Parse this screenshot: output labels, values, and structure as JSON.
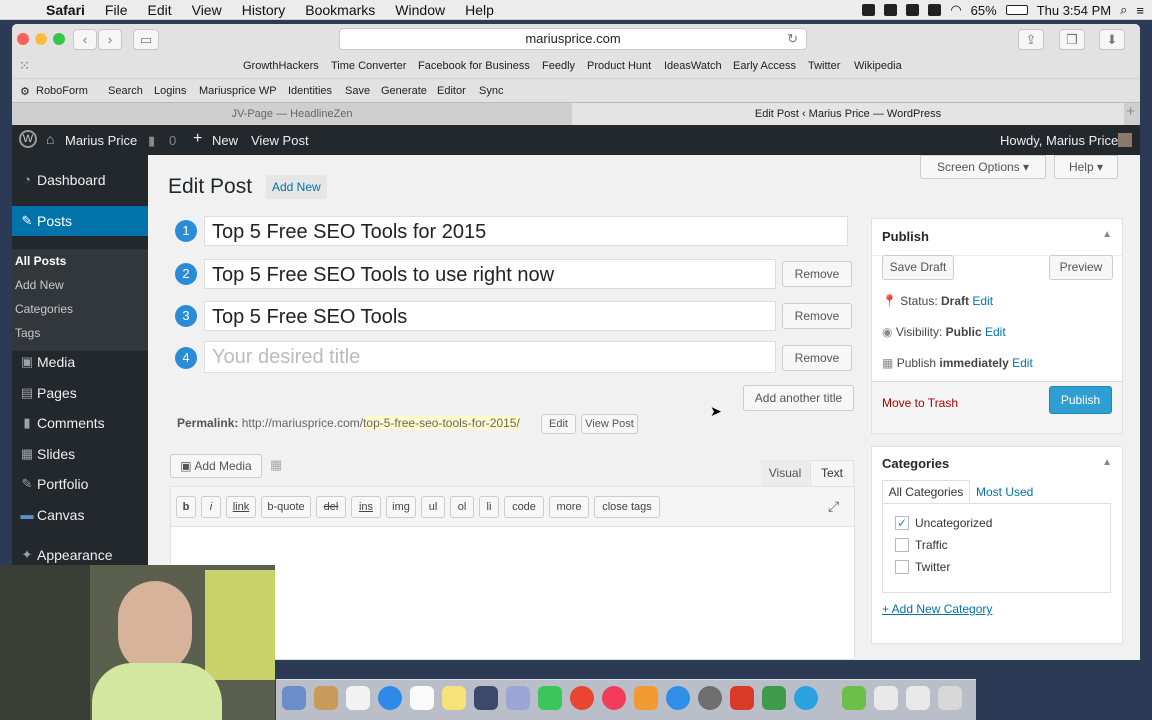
{
  "mac_menu": {
    "app": "Safari",
    "items": [
      "File",
      "Edit",
      "View",
      "History",
      "Bookmarks",
      "Window",
      "Help"
    ],
    "battery": "65%",
    "clock": "Thu 3:54 PM"
  },
  "browser": {
    "url": "mariusprice.com",
    "favorites": [
      "GrowthHackers",
      "Time Converter",
      "Facebook for Business",
      "Feedly",
      "Product Hunt",
      "IdeasWatch",
      "Early Access",
      "Twitter",
      "Wikipedia"
    ],
    "roboform": [
      "RoboForm",
      "Search",
      "Logins",
      "Mariusprice WP",
      "Identities",
      "Save",
      "Generate",
      "Editor",
      "Sync"
    ],
    "tabs": [
      "JV-Page — HeadlineZen",
      "Edit Post ‹ Marius Price — WordPress"
    ]
  },
  "adminbar": {
    "site": "Marius Price",
    "comments": "0",
    "new": "New",
    "view_post": "View Post",
    "howdy": "Howdy, Marius Price"
  },
  "sidebar": {
    "items": [
      "Dashboard",
      "Posts",
      "Media",
      "Pages",
      "Comments",
      "Slides",
      "Portfolio",
      "Canvas",
      "Appearance"
    ],
    "submenu": [
      "All Posts",
      "Add New",
      "Categories",
      "Tags"
    ]
  },
  "page": {
    "title": "Edit Post",
    "add_new": "Add New",
    "screen_options": "Screen Options",
    "help": "Help"
  },
  "titles": [
    {
      "num": "1",
      "value": "Top 5 Free SEO Tools for 2015"
    },
    {
      "num": "2",
      "value": "Top 5 Free SEO Tools to use right now",
      "action": "Remove"
    },
    {
      "num": "3",
      "value": "Top 5 Free SEO Tools",
      "action": "Remove"
    },
    {
      "num": "4",
      "placeholder": "Your desired title",
      "action": "Remove"
    }
  ],
  "add_title": "Add another title",
  "permalink": {
    "label": "Permalink:",
    "base": "http://mariusprice.com/",
    "slug": "top-5-free-seo-tools-for-2015/",
    "edit": "Edit",
    "view": "View Post"
  },
  "editor": {
    "add_media": "Add Media",
    "tab_visual": "Visual",
    "tab_text": "Text",
    "quicktags": [
      "b",
      "i",
      "link",
      "b-quote",
      "del",
      "ins",
      "img",
      "ul",
      "ol",
      "li",
      "code",
      "more",
      "close tags"
    ]
  },
  "publish": {
    "heading": "Publish",
    "save_draft": "Save Draft",
    "preview": "Preview",
    "status_label": "Status:",
    "status_value": "Draft",
    "visibility_label": "Visibility:",
    "visibility_value": "Public",
    "publish_label": "Publish",
    "publish_value": "immediately",
    "edit": "Edit",
    "trash": "Move to Trash",
    "publish_btn": "Publish"
  },
  "categories": {
    "heading": "Categories",
    "tab_all": "All Categories",
    "tab_used": "Most Used",
    "items": [
      {
        "label": "Uncategorized",
        "checked": true
      },
      {
        "label": "Traffic",
        "checked": false
      },
      {
        "label": "Twitter",
        "checked": false
      }
    ],
    "add_new": "+ Add New Category"
  }
}
